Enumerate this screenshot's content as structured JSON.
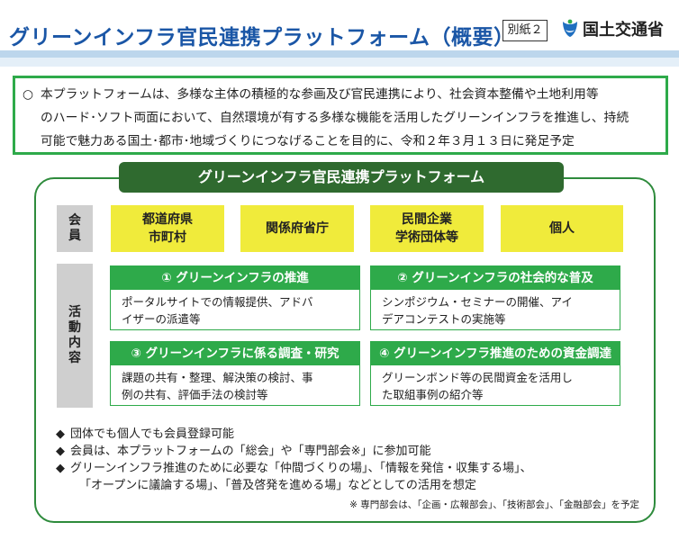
{
  "header": {
    "title": "グリーンインフラ官民連携プラットフォーム（概要）",
    "annex": "別紙２",
    "ministry": "国土交通省",
    "logo_icon": "mlit-logo-icon"
  },
  "summary": {
    "bullet": "○",
    "lines": [
      "本プラットフォームは、多様な主体の積極的な参画及び官民連携により、社会資本整備や土地利用等",
      "のハード･ソフト両面において、自然環境が有する多様な機能を活用したグリーンインフラを推進し、持続",
      "可能で魅力ある国土･都市･地域づくりにつなげることを目的に、令和２年３月１３日に発足予定"
    ]
  },
  "platform": {
    "banner": "グリーンインフラ官民連携プラットフォーム",
    "member_label_1": "会",
    "member_label_2": "員",
    "activity_label": [
      "活",
      "動",
      "内",
      "容"
    ],
    "members": [
      {
        "line1": "都道府県",
        "line2": "市町村"
      },
      {
        "line1": "関係府省庁",
        "line2": ""
      },
      {
        "line1": "民間企業",
        "line2": "学術団体等"
      },
      {
        "line1": "個人",
        "line2": ""
      }
    ],
    "activities": [
      {
        "title": "① グリーンインフラの推進",
        "body1": "ポータルサイトでの情報提供、アドバ",
        "body2": "イザーの派遣等"
      },
      {
        "title": "② グリーンインフラの社会的な普及",
        "body1": "シンポジウム・セミナーの開催、アイ",
        "body2": "デアコンテストの実施等"
      },
      {
        "title": "③ グリーンインフラに係る調査・研究",
        "body1": "課題の共有・整理、解決策の検討、事",
        "body2": "例の共有、評価手法の検討等"
      },
      {
        "title": "④ グリーンインフラ推進のための資金調達",
        "body1": "グリーンボンド等の民間資金を活用し",
        "body2": "た取組事例の紹介等"
      }
    ]
  },
  "notes": {
    "diamond": "◆",
    "n1": "団体でも個人でも会員登録可能",
    "n2": "会員は、本プラットフォームの「総会」や「専門部会※」に参加可能",
    "n3a": "グリーンインフラ推進のために必要な「仲間づくりの場」、「情報を発信・収集する場」、",
    "n3b": "「オープンに議論する場」、「普及啓発を進める場」などとしての活用を想定",
    "footnote": "※ 専門部会は、「企画・広報部会」、「技術部会」、「金融部会」を予定"
  },
  "colors": {
    "title_blue": "#1a56a6",
    "banner_green": "#2f6a2f",
    "accent_green": "#2eaa4a",
    "member_yellow": "#f0eb3b"
  }
}
